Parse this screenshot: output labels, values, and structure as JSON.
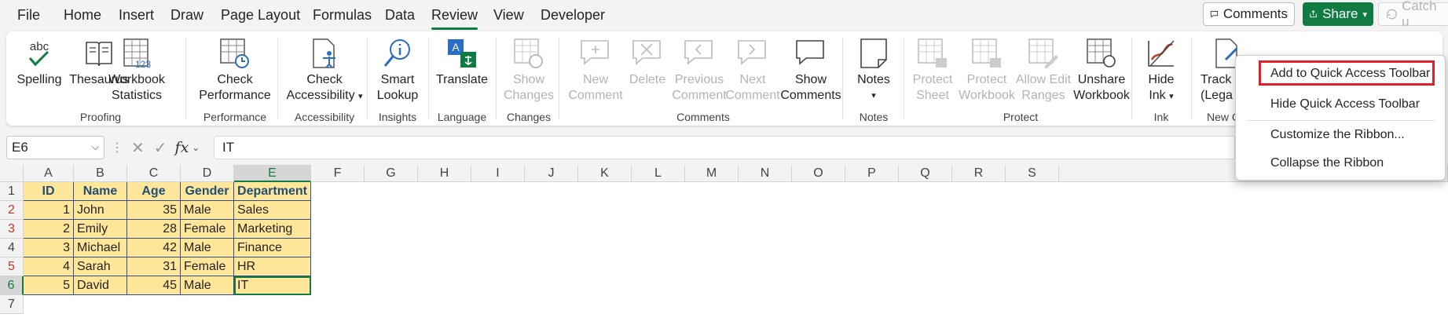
{
  "menu": {
    "tabs": [
      "File",
      "Home",
      "Insert",
      "Draw",
      "Page Layout",
      "Formulas",
      "Data",
      "Review",
      "View",
      "Developer"
    ],
    "active": "Review",
    "comments_label": "Comments",
    "share_label": "Share",
    "catchup_label": "Catch u"
  },
  "ribbon": {
    "proofing": {
      "spelling": "Spelling",
      "spelling_icon_text": "abc",
      "thesaurus": "Thesaurus",
      "workbook": "Workbook",
      "statistics": "Statistics",
      "statistics_icon_text": "123",
      "label": "Proofing"
    },
    "performance": {
      "check": "Check",
      "performance": "Performance",
      "label": "Performance"
    },
    "accessibility": {
      "check": "Check",
      "accessibility": "Accessibility",
      "label": "Accessibility"
    },
    "insights": {
      "smart": "Smart",
      "lookup": "Lookup",
      "label": "Insights"
    },
    "language": {
      "translate": "Translate",
      "label": "Language"
    },
    "changes": {
      "show": "Show",
      "changes": "Changes",
      "label": "Changes"
    },
    "comments": {
      "new1": "New",
      "new2": "Comment",
      "delete": "Delete",
      "prev1": "Previous",
      "prev2": "Comment",
      "next1": "Next",
      "next2": "Comment",
      "show1": "Show",
      "show2": "Comments",
      "label": "Comments"
    },
    "notes": {
      "notes": "Notes",
      "label": "Notes"
    },
    "protect": {
      "ps1": "Protect",
      "ps2": "Sheet",
      "pw1": "Protect",
      "pw2": "Workbook",
      "ae1": "Allow Edit",
      "ae2": "Ranges",
      "uw1": "Unshare",
      "uw2": "Workbook",
      "label": "Protect"
    },
    "ink": {
      "hide": "Hide",
      "ink": "Ink",
      "label": "Ink"
    },
    "track": {
      "t1": "Track C",
      "t2": "(Lega",
      "label": "New C"
    }
  },
  "formula_bar": {
    "name_box": "E6",
    "fx": "fx",
    "value": "IT"
  },
  "grid": {
    "columns": [
      "A",
      "B",
      "C",
      "D",
      "E",
      "F",
      "G",
      "H",
      "I",
      "J",
      "K",
      "L",
      "M",
      "N",
      "O",
      "P",
      "Q",
      "R",
      "S"
    ],
    "rows": [
      "1",
      "2",
      "3",
      "4",
      "5",
      "6",
      "7"
    ],
    "header": [
      "ID",
      "Name",
      "Age",
      "Gender",
      "Department"
    ],
    "data": [
      [
        "1",
        "John",
        "35",
        "Male",
        "Sales"
      ],
      [
        "2",
        "Emily",
        "28",
        "Female",
        "Marketing"
      ],
      [
        "3",
        "Michael",
        "42",
        "Male",
        "Finance"
      ],
      [
        "4",
        "Sarah",
        "31",
        "Female",
        "HR"
      ],
      [
        "5",
        "David",
        "45",
        "Male",
        "IT"
      ]
    ]
  },
  "context_menu": {
    "items": [
      "Add to Quick Access Toolbar",
      "Hide Quick Access Toolbar",
      "Customize the Ribbon...",
      "Collapse the Ribbon"
    ]
  },
  "colors": {
    "accent": "#107c41",
    "table_fill": "#ffe699",
    "highlight": "#e2202a"
  }
}
